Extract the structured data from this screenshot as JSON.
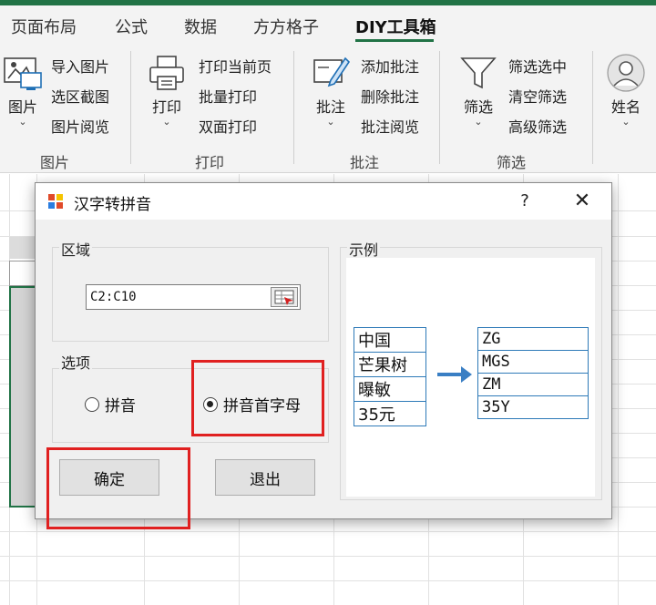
{
  "ribbon": {
    "tabs": [
      {
        "label": "页面布局"
      },
      {
        "label": "公式"
      },
      {
        "label": "数据"
      },
      {
        "label": "方方格子"
      },
      {
        "label": "DIY工具箱"
      }
    ],
    "groups": {
      "picture": {
        "label": "图片",
        "big_button": "图片",
        "items": [
          "导入图片",
          "选区截图",
          "图片阅览"
        ]
      },
      "print": {
        "label": "打印",
        "big_button": "打印",
        "items": [
          "打印当前页",
          "批量打印",
          "双面打印"
        ]
      },
      "comment": {
        "label": "批注",
        "big_button": "批注",
        "items": [
          "添加批注",
          "删除批注",
          "批注阅览"
        ]
      },
      "filter": {
        "label": "筛选",
        "big_button": "筛选",
        "items": [
          "筛选选中",
          "清空筛选",
          "高级筛选"
        ]
      },
      "name": {
        "big_button": "姓名"
      }
    },
    "accent_color": "#217346"
  },
  "dialog": {
    "title": "汉字转拼音",
    "help_glyph": "?",
    "close_glyph": "✕",
    "region": {
      "label": "区域",
      "value": "C2:C10"
    },
    "options": {
      "label": "选项",
      "radio_pinyin": "拼音",
      "radio_initials": "拼音首字母",
      "selected": "拼音首字母"
    },
    "example": {
      "label": "示例",
      "source": [
        "中国",
        "芒果树",
        "曝敏",
        "35元"
      ],
      "result": [
        "ZG",
        "MGS",
        "ZM",
        "35Y"
      ]
    },
    "ok_button": "确定",
    "exit_button": "退出",
    "highlight_color": "#e02020"
  }
}
